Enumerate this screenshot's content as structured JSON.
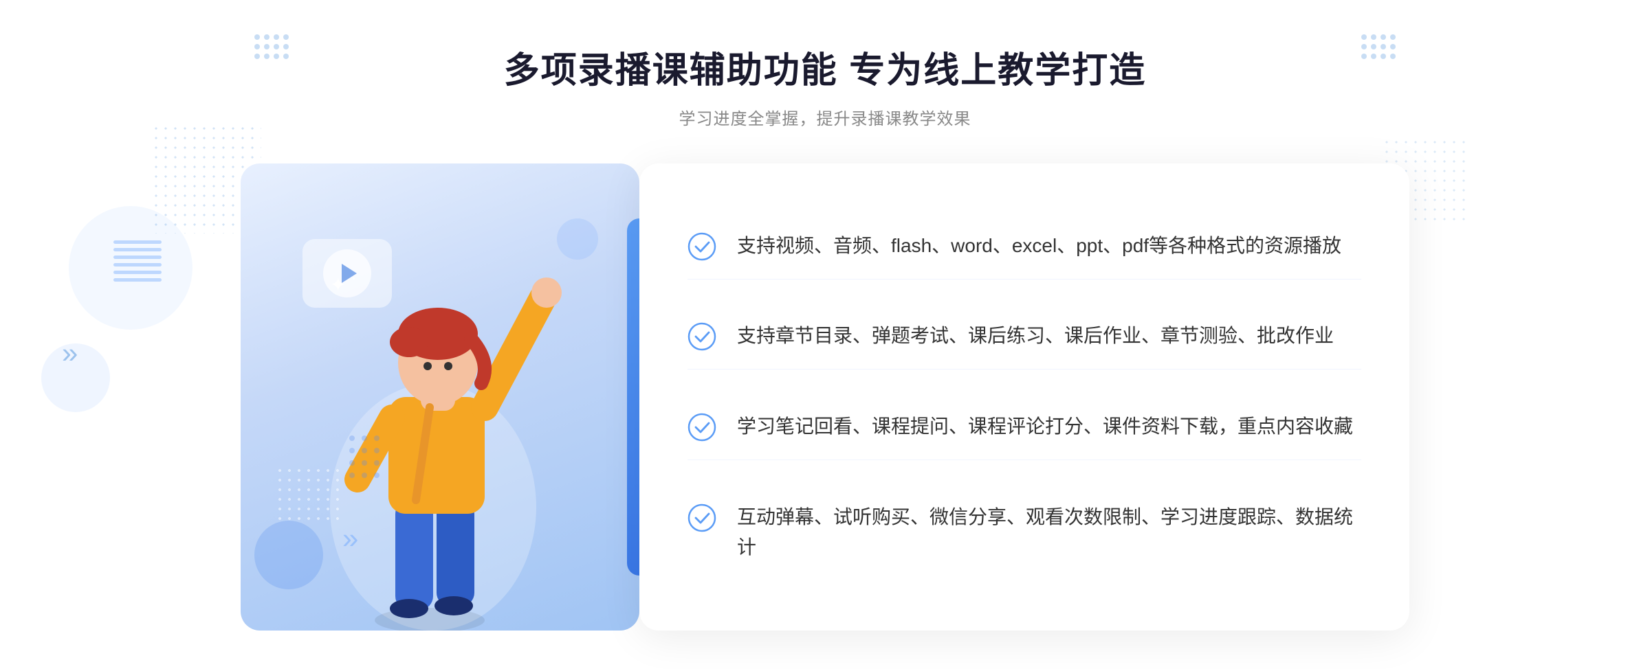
{
  "page": {
    "main_title": "多项录播课辅助功能 专为线上教学打造",
    "sub_title": "学习进度全掌握，提升录播课教学效果"
  },
  "features": [
    {
      "id": "feature-1",
      "text": "支持视频、音频、flash、word、excel、ppt、pdf等各种格式的资源播放"
    },
    {
      "id": "feature-2",
      "text": "支持章节目录、弹题考试、课后练习、课后作业、章节测验、批改作业"
    },
    {
      "id": "feature-3",
      "text": "学习笔记回看、课程提问、课程评论打分、课件资料下载，重点内容收藏"
    },
    {
      "id": "feature-4",
      "text": "互动弹幕、试听购买、微信分享、观看次数限制、学习进度跟踪、数据统计"
    }
  ],
  "icons": {
    "check": "check-circle-icon",
    "play": "play-icon",
    "chevron": "chevron-icon"
  },
  "colors": {
    "primary": "#4a8ef8",
    "primary_dark": "#2563eb",
    "text_dark": "#1a1a2e",
    "text_gray": "#888888",
    "text_body": "#333333",
    "check_color": "#5b9cf6",
    "bg_gradient_start": "#e8f0fe",
    "bg_gradient_end": "#a0c4f4"
  }
}
